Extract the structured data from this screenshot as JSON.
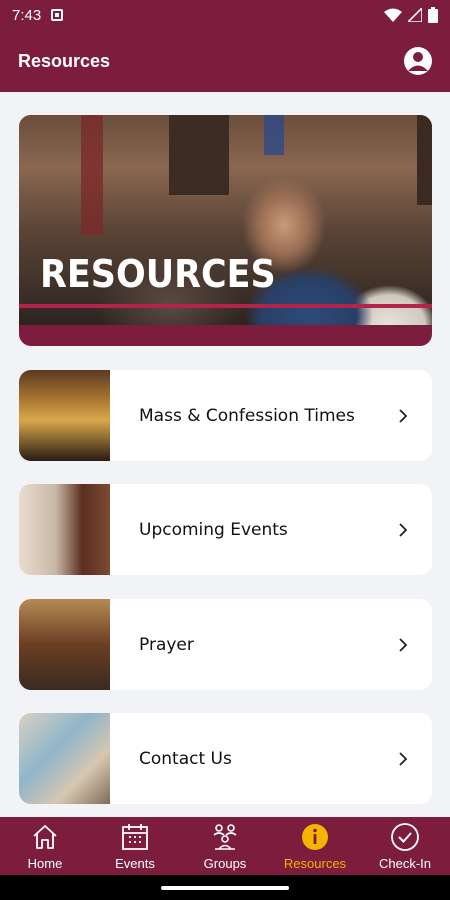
{
  "status_bar": {
    "time": "7:43"
  },
  "app_bar": {
    "title": "Resources"
  },
  "hero": {
    "title": "RESOURCES"
  },
  "cards": [
    {
      "label": "Mass & Confession Times"
    },
    {
      "label": "Upcoming Events"
    },
    {
      "label": "Prayer"
    },
    {
      "label": "Contact Us"
    }
  ],
  "bottom_nav": {
    "items": [
      {
        "label": "Home",
        "icon": "home-icon"
      },
      {
        "label": "Events",
        "icon": "calendar-icon"
      },
      {
        "label": "Groups",
        "icon": "groups-icon"
      },
      {
        "label": "Resources",
        "icon": "info-icon",
        "active": true
      },
      {
        "label": "Check-In",
        "icon": "check-circle-icon"
      }
    ]
  },
  "colors": {
    "brand": "#7c1d3d",
    "active": "#f4b400",
    "accent_line": "#b3244a"
  }
}
